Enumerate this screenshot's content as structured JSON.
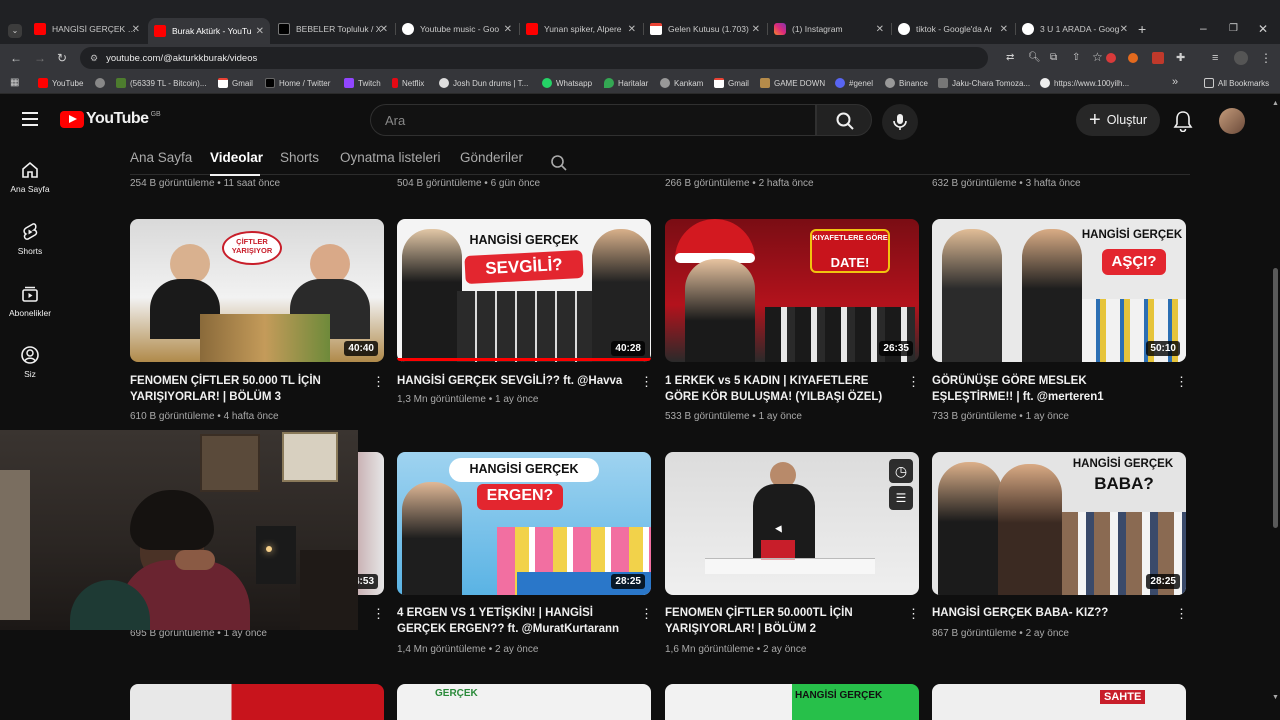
{
  "browser": {
    "tabs": [
      {
        "title": "HANGİSİ GERÇEK SEV",
        "favicon": "youtube"
      },
      {
        "title": "Burak Aktürk - YouTu",
        "favicon": "youtube",
        "active": true
      },
      {
        "title": "BEBELER Topluluk / X",
        "favicon": "x"
      },
      {
        "title": "Youtube music - Goo",
        "favicon": "google"
      },
      {
        "title": "Yunan spiker, Alpere",
        "favicon": "youtube"
      },
      {
        "title": "Gelen Kutusu (1.703)",
        "favicon": "gmail"
      },
      {
        "title": "(1) Instagram",
        "favicon": "instagram"
      },
      {
        "title": "tiktok - Google'da Ar",
        "favicon": "google"
      },
      {
        "title": "3 U 1 ARADA - Goog",
        "favicon": "google"
      }
    ],
    "url": "youtube.com/@akturkkburak/videos",
    "bookmarks": [
      "YouTube",
      "(56339 TL - Bitcoin)...",
      "Gmail",
      "Home / Twitter",
      "Twitch",
      "Netflix",
      "Josh Dun drums | T...",
      "Whatsapp",
      "Haritalar",
      "Kankam",
      "Gmail",
      "GAME DOWN",
      "#genel",
      "Binance",
      "Jaku-Chara Tomoza...",
      "https://www.100yilh..."
    ],
    "all_bookmarks": "All Bookmarks"
  },
  "youtube": {
    "logo": "YouTube",
    "region": "GB",
    "search_placeholder": "Ara",
    "create_label": "Oluştur",
    "sidebar": [
      {
        "label": "Ana Sayfa",
        "icon": "home-icon"
      },
      {
        "label": "Shorts",
        "icon": "shorts-icon"
      },
      {
        "label": "Abonelikler",
        "icon": "subscriptions-icon"
      },
      {
        "label": "Siz",
        "icon": "you-icon"
      }
    ],
    "channel_tabs": [
      "Ana Sayfa",
      "Videolar",
      "Shorts",
      "Oynatma listeleri",
      "Gönderiler"
    ],
    "top_row_meta": [
      {
        "views": "254 B görüntüleme",
        "age": "11 saat önce"
      },
      {
        "views": "504 B görüntüleme",
        "age": "6 gün önce"
      },
      {
        "views": "266 B görüntüleme",
        "age": "2 hafta önce"
      },
      {
        "views": "632 B görüntüleme",
        "age": "3 hafta önce"
      }
    ],
    "videos": [
      {
        "title": "FENOMEN ÇİFTLER 50.000 TL İÇİN YARIŞIYORLAR! | BÖLÜM 3",
        "views": "610 B görüntüleme",
        "age": "4 hafta önce",
        "duration": "40:40",
        "thumb_text": "ÇİFTLER YARIŞIYOR"
      },
      {
        "title": "HANGİSİ GERÇEK SEVGİLİ?? ft. @Havva",
        "views": "1,3 Mn görüntüleme",
        "age": "1 ay önce",
        "duration": "40:28",
        "thumb_text": "HANGİSİ GERÇEK",
        "thumb_text2": "SEVGİLİ?"
      },
      {
        "title": "1 ERKEK vs 5 KADIN | KIYAFETLERE GÖRE KÖR BULUŞMA! (YILBAŞI ÖZEL)",
        "views": "533 B görüntüleme",
        "age": "1 ay önce",
        "duration": "26:35",
        "thumb_text": "KIYAFETLERE GÖRE",
        "thumb_text2": "DATE!"
      },
      {
        "title": "GÖRÜNÜŞE GÖRE MESLEK EŞLEŞTİRME!! | ft. @merteren1",
        "views": "733 B görüntüleme",
        "age": "1 ay önce",
        "duration": "50:10",
        "thumb_text": "HANGİSİ GERÇEK",
        "thumb_text2": "AŞÇI?"
      },
      {
        "title": "",
        "views": "695 B görüntüleme",
        "age": "1 ay önce",
        "duration": "4:53"
      },
      {
        "title": "4 ERGEN VS 1 YETİŞKİN! | HANGİSİ GERÇEK ERGEN?? ft. @MuratKurtarann",
        "views": "1,4 Mn görüntüleme",
        "age": "2 ay önce",
        "duration": "28:25",
        "thumb_text": "HANGİSİ GERÇEK",
        "thumb_text2": "ERGEN?"
      },
      {
        "title": "FENOMEN ÇİFTLER 50.000TL İÇİN YARIŞIYORLAR! | BÖLÜM 2",
        "views": "1,6 Mn görüntüleme",
        "age": "2 ay önce",
        "duration": ""
      },
      {
        "title": "HANGİSİ GERÇEK BABA- KIZ??",
        "views": "867 B görüntüleme",
        "age": "2 ay önce",
        "duration": "28:25",
        "thumb_text": "HANGİSİ GERÇEK",
        "thumb_text2": "BABA?"
      }
    ],
    "bottom_row_thumb_texts": [
      "",
      "GERÇEK",
      "HANGİSİ GERÇEK",
      "SAHTE"
    ]
  },
  "colors": {
    "accent": "#ff0000",
    "bg": "#0f0f0f",
    "chrome": "#35363a"
  }
}
